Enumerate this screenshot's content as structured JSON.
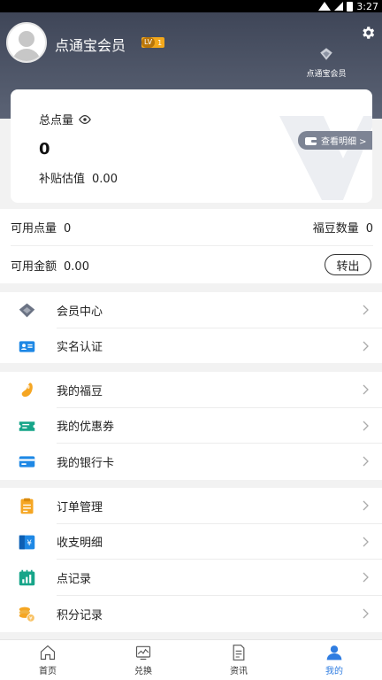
{
  "status_bar": {
    "time": "3:27"
  },
  "header": {
    "username": "点通宝会员",
    "level_prefix": "LV",
    "level": "1",
    "member_link_label": "点通宝会员"
  },
  "points_card": {
    "total_label": "总点量",
    "total_value": "0",
    "subsidy_label": "补贴估值",
    "subsidy_value": "0.00",
    "detail_button": "查看明细 >"
  },
  "balances": {
    "available_points_label": "可用点量",
    "available_points_value": "0",
    "fudou_count_label": "福豆数量",
    "fudou_count_value": "0",
    "available_amount_label": "可用金额",
    "available_amount_value": "0.00",
    "transfer_button": "转出"
  },
  "menu": {
    "group1": [
      {
        "label": "会员中心",
        "icon": "diamond-icon"
      },
      {
        "label": "实名认证",
        "icon": "id-card-icon"
      }
    ],
    "group2": [
      {
        "label": "我的福豆",
        "icon": "bean-icon"
      },
      {
        "label": "我的优惠券",
        "icon": "coupon-icon"
      },
      {
        "label": "我的银行卡",
        "icon": "bank-card-icon"
      }
    ],
    "group3": [
      {
        "label": "订单管理",
        "icon": "clipboard-icon"
      },
      {
        "label": "收支明细",
        "icon": "wallet-yen-icon"
      },
      {
        "label": "点记录",
        "icon": "chart-record-icon"
      },
      {
        "label": "积分记录",
        "icon": "coins-icon"
      }
    ]
  },
  "bottom_nav": [
    {
      "label": "首页",
      "icon": "home-icon"
    },
    {
      "label": "兑换",
      "icon": "exchange-icon"
    },
    {
      "label": "资讯",
      "icon": "news-icon"
    },
    {
      "label": "我的",
      "icon": "profile-icon",
      "active": true
    }
  ],
  "colors": {
    "header_top": "#3f4658",
    "header_bottom": "#5b6375",
    "accent_blue": "#2f7de1",
    "icon_blue": "#1e88e5",
    "icon_teal": "#17a589",
    "icon_orange": "#f5a623"
  }
}
